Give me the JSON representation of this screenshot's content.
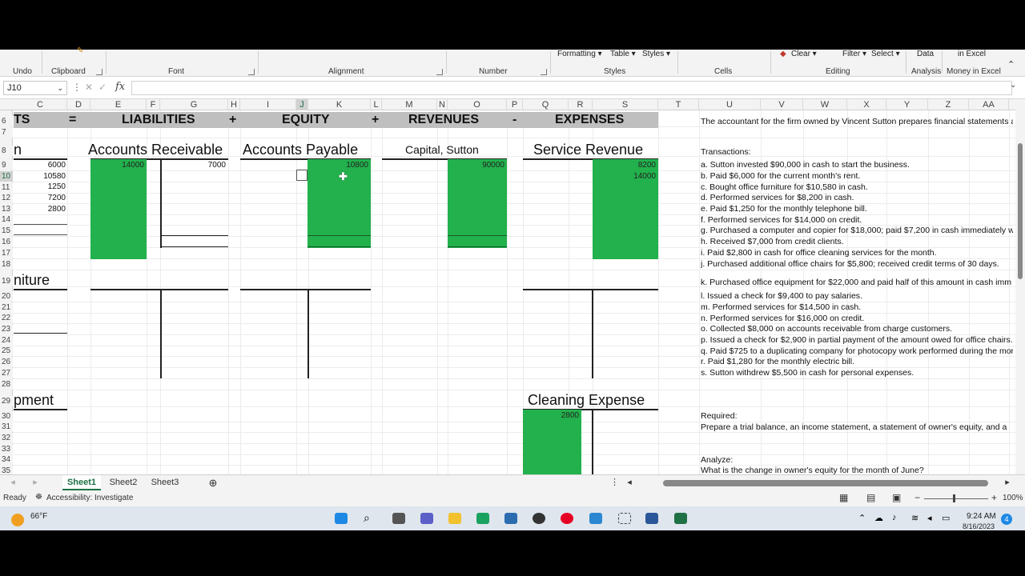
{
  "ribbon": {
    "top_labels": {
      "formatting": "Formatting ▾",
      "table": "Table ▾",
      "styles": "Styles ▾",
      "clear": "Clear ▾",
      "filter": "Filter ▾",
      "select": "Select ▾",
      "data": "Data",
      "in_excel": "in Excel"
    },
    "groups": {
      "undo": "Undo",
      "clipboard": "Clipboard",
      "font": "Font",
      "alignment": "Alignment",
      "number": "Number",
      "styles": "Styles",
      "cells": "Cells",
      "editing": "Editing",
      "analysis": "Analysis",
      "money": "Money in Excel"
    }
  },
  "formula_bar": {
    "name_box": "J10",
    "fx": "fx",
    "content": ""
  },
  "columns": [
    "C",
    "D",
    "E",
    "F",
    "G",
    "H",
    "I",
    "J",
    "K",
    "L",
    "M",
    "N",
    "O",
    "P",
    "Q",
    "R",
    "S",
    "T",
    "U",
    "V",
    "W",
    "X",
    "Y",
    "Z",
    "AA"
  ],
  "rows": [
    "6",
    "7",
    "8",
    "9",
    "10",
    "11",
    "12",
    "13",
    "14",
    "15",
    "16",
    "17",
    "18",
    "19",
    "20",
    "21",
    "22",
    "23",
    "24",
    "25",
    "26",
    "27",
    "28",
    "29",
    "30",
    "31",
    "32",
    "33",
    "34",
    "35"
  ],
  "equation": {
    "assets": "TS",
    "eq": "=",
    "liabilities": "LIABILITIES",
    "plus1": "+",
    "equity": "EQUITY",
    "plus2": "+",
    "revenues": "REVENUES",
    "minus": "-",
    "expenses": "EXPENSES"
  },
  "accounts": {
    "cash": "n",
    "accounts_receivable": "Accounts Receivable",
    "accounts_payable": "Accounts Payable",
    "capital": "Capital, Sutton",
    "service_revenue": "Service Revenue",
    "furniture": "niture",
    "equipment": "pment",
    "cleaning_expense": "Cleaning Expense"
  },
  "values": {
    "cash": [
      "6000",
      "10580",
      "1250",
      "7200",
      "2800"
    ],
    "ar_debit": "14000",
    "ar_credit": "7000",
    "ap_credit": "10800",
    "capital_credit": "90000",
    "revenue_credit": [
      "8200",
      "14000"
    ],
    "cleaning_debit": "2800"
  },
  "problem": {
    "intro": "The accountant for the firm owned by Vincent Sutton prepares financial statements a",
    "transactions_label": "Transactions:",
    "items": [
      "a. Sutton invested $90,000 in cash to start the business.",
      "b. Paid $6,000 for the current month's rent.",
      "c. Bought office furniture for $10,580 in cash.",
      "d. Performed services for $8,200 in cash.",
      "e. Paid $1,250 for the monthly telephone bill.",
      "f. Performed services for $14,000 on credit.",
      "g. Purchased a computer and copier for $18,000; paid $7,200 in cash immediately w",
      "h. Received $7,000 from credit clients.",
      "i. Paid $2,800 in cash for office cleaning services for the month.",
      "j. Purchased additional office chairs for $5,800; received credit terms of 30 days.",
      "k. Purchased office equipment for $22,000 and paid half of this amount in cash imm",
      "l. Issued a check for $9,400 to pay salaries.",
      "m. Performed services for $14,500 in cash.",
      "n. Performed services for $16,000 on credit.",
      "o. Collected $8,000 on accounts receivable from charge customers.",
      "p. Issued a check for $2,900 in partial payment of the amount owed for office chairs.",
      "q. Paid $725 to a duplicating company for photocopy work performed during the mor",
      "r. Paid $1,280 for the monthly electric bill.",
      "s. Sutton withdrew $5,500 in cash for personal expenses."
    ],
    "required_label": "Required:",
    "required_text": "Prepare a trial balance, an income statement, a statement of owner's equity, and a",
    "analyze_label": "Analyze:",
    "analyze_text": "What is the change in owner's equity for the month of June?"
  },
  "sheet_tabs": [
    "Sheet1",
    "Sheet2",
    "Sheet3"
  ],
  "status": {
    "ready": "Ready",
    "accessibility": "Accessibility: Investigate",
    "zoom": "100%"
  },
  "taskbar": {
    "weather": "66°F",
    "time": "9:24 AM",
    "date": "8/16/2023",
    "badge": "4"
  },
  "colors": {
    "green": "#22b14c",
    "band": "#bfbfbf"
  }
}
